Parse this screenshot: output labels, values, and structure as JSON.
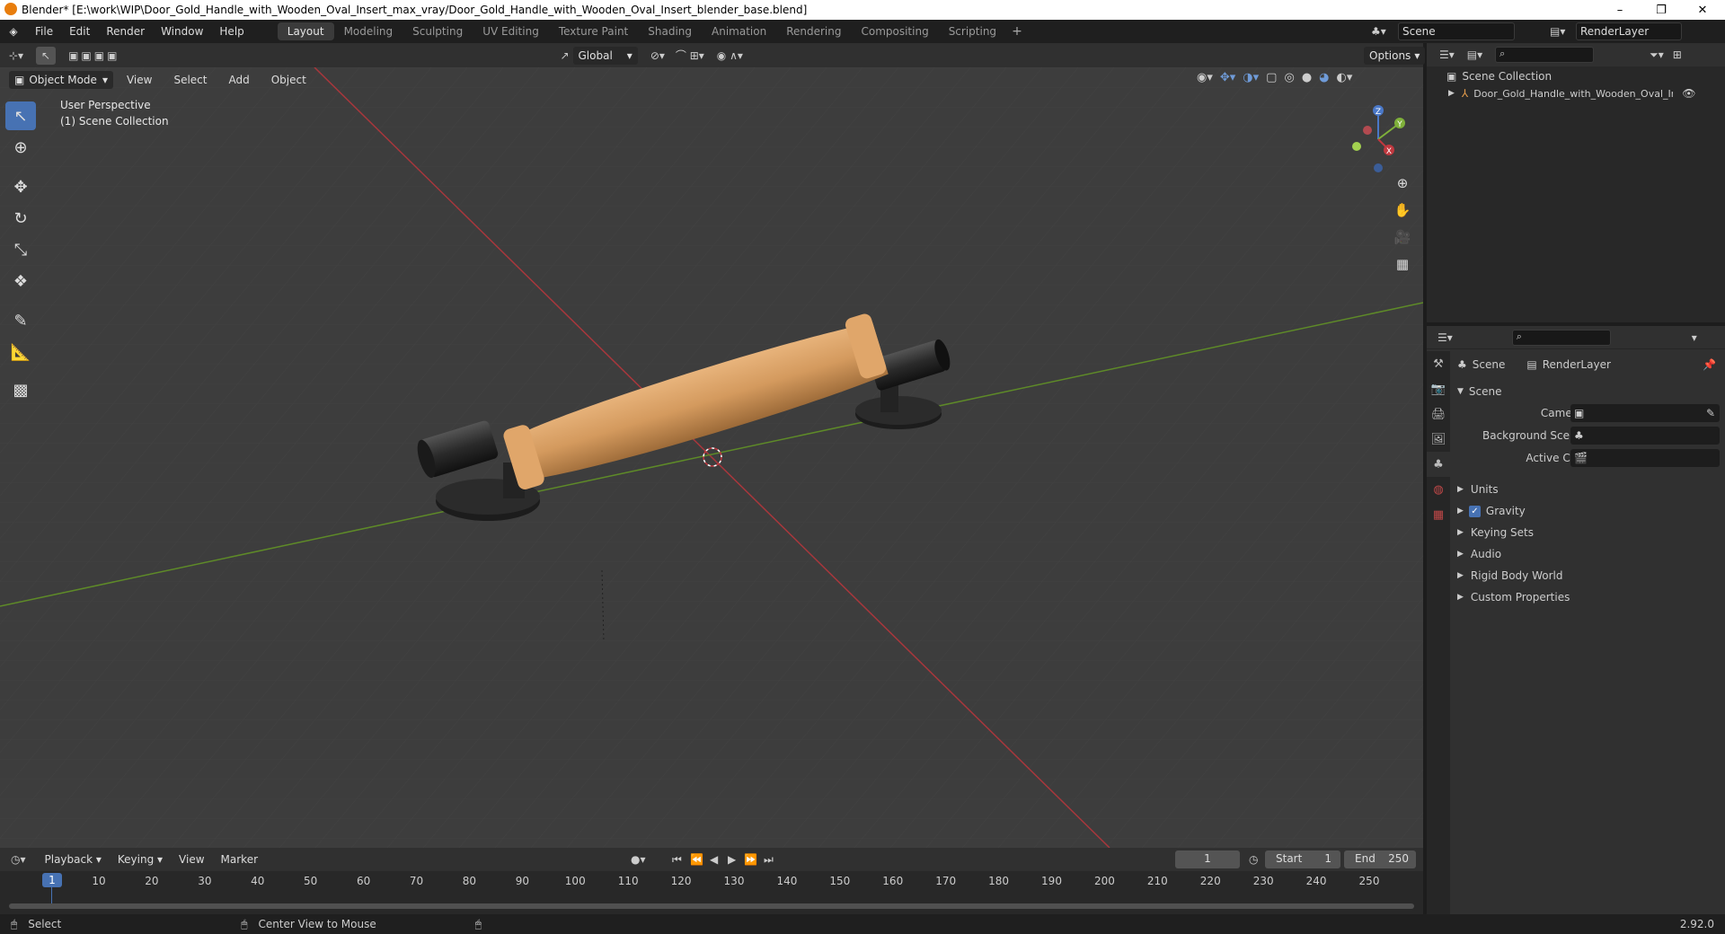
{
  "window": {
    "title": "Blender* [E:\\work\\WIP\\Door_Gold_Handle_with_Wooden_Oval_Insert_max_vray/Door_Gold_Handle_with_Wooden_Oval_Insert_blender_base.blend]",
    "controls": [
      "–",
      "❐",
      "✕"
    ]
  },
  "menus": [
    "File",
    "Edit",
    "Render",
    "Window",
    "Help"
  ],
  "workspaces": [
    "Layout",
    "Modeling",
    "Sculpting",
    "UV Editing",
    "Texture Paint",
    "Shading",
    "Animation",
    "Rendering",
    "Compositing",
    "Scripting"
  ],
  "active_workspace": "Layout",
  "scene_selector": "Scene",
  "renderlayer_selector": "RenderLayer",
  "viewport_header": {
    "transform_orientation": "Global",
    "options_label": "Options",
    "mode": "Object Mode",
    "menus": [
      "View",
      "Select",
      "Add",
      "Object"
    ]
  },
  "viewport": {
    "perspective_label": "User Perspective",
    "collection_label": "(1) Scene Collection",
    "gizmo_axes": [
      "X",
      "Y",
      "Z"
    ]
  },
  "outliner": {
    "root": "Scene Collection",
    "items": [
      {
        "label": "Door_Gold_Handle_with_Wooden_Oval_Insert"
      }
    ]
  },
  "properties": {
    "breadcrumb_scene": "Scene",
    "breadcrumb_layer": "RenderLayer",
    "section_title": "Scene",
    "fields": [
      {
        "label": "Camera",
        "value": ""
      },
      {
        "label": "Background Scene",
        "value": ""
      },
      {
        "label": "Active Clip",
        "value": ""
      }
    ],
    "panels": [
      {
        "label": "Units",
        "checkbox": false
      },
      {
        "label": "Gravity",
        "checkbox": true
      },
      {
        "label": "Keying Sets",
        "checkbox": false
      },
      {
        "label": "Audio",
        "checkbox": false
      },
      {
        "label": "Rigid Body World",
        "checkbox": false
      },
      {
        "label": "Custom Properties",
        "checkbox": false
      }
    ]
  },
  "timeline": {
    "menus": [
      "Playback",
      "Keying",
      "View",
      "Marker"
    ],
    "current_frame": "1",
    "start_label": "Start",
    "start_value": "1",
    "end_label": "End",
    "end_value": "250",
    "ticks": [
      "1",
      "10",
      "20",
      "30",
      "40",
      "50",
      "60",
      "70",
      "80",
      "90",
      "100",
      "110",
      "120",
      "130",
      "140",
      "150",
      "160",
      "170",
      "180",
      "190",
      "200",
      "210",
      "220",
      "230",
      "240",
      "250"
    ]
  },
  "statusbar": {
    "left": "Select",
    "middle": "Center View to Mouse",
    "version": "2.92.0"
  },
  "colors": {
    "accent": "#4772b3",
    "x_axis": "#c0383f",
    "y_axis": "#6b9a2a",
    "wood": "#d49a5e"
  }
}
